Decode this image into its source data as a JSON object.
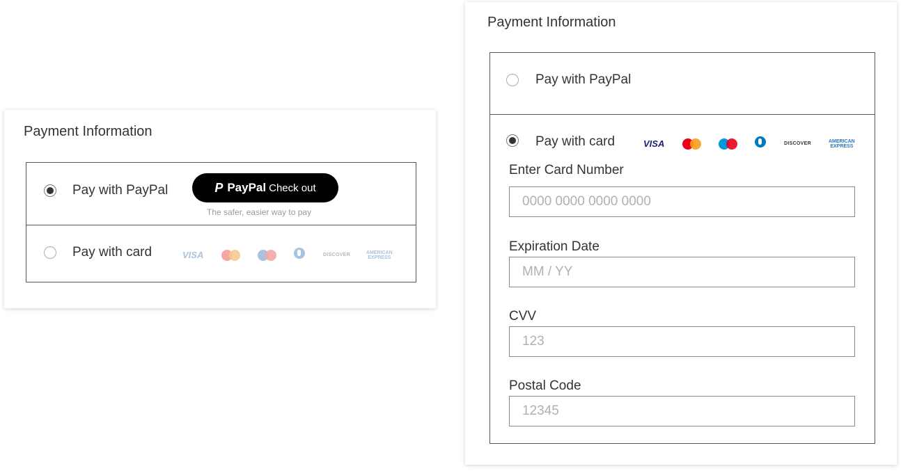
{
  "left_panel": {
    "title": "Payment Information",
    "paypal_option": {
      "label": "Pay with PayPal",
      "selected": true
    },
    "paypal_button": {
      "brand": "PayPal",
      "action": "Check out",
      "tagline": "The safer, easier way to pay"
    },
    "card_option": {
      "label": "Pay with card",
      "selected": false
    }
  },
  "right_panel": {
    "title": "Payment Information",
    "paypal_option": {
      "label": "Pay with PayPal",
      "selected": false
    },
    "card_option": {
      "label": "Pay with card",
      "selected": true
    },
    "fields": {
      "card_number": {
        "label": "Enter Card Number",
        "placeholder": "0000 0000 0000 0000",
        "value": ""
      },
      "expiration": {
        "label": "Expiration Date",
        "placeholder": "MM / YY",
        "value": ""
      },
      "cvv": {
        "label": "CVV",
        "placeholder": "123",
        "value": ""
      },
      "postal": {
        "label": "Postal Code",
        "placeholder": "12345",
        "value": ""
      }
    }
  },
  "card_logos": {
    "visa": "VISA",
    "discover": "DISCOVER",
    "amex_line1": "AMERICAN",
    "amex_line2": "EXPRESS"
  },
  "colors": {
    "visa_blue": "#1a1f71",
    "mastercard_red": "#eb001b",
    "mastercard_orange": "#f79e1b",
    "maestro_blue": "#0099df",
    "diners_blue": "#0079be",
    "amex_blue": "#2e77bb",
    "discover_orange": "#f58220",
    "muted_logo": "#a9c2e0",
    "muted_red": "#f4a6a6",
    "muted_orange": "#f7c98f"
  }
}
